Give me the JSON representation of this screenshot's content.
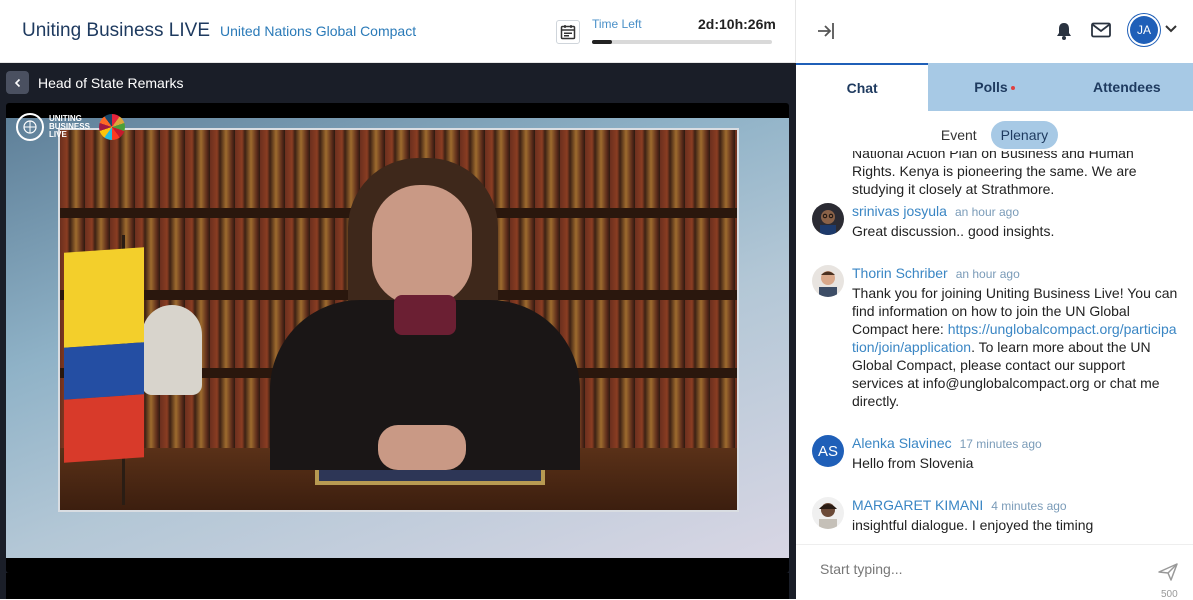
{
  "header": {
    "app_title": "Uniting Business LIVE",
    "org_link": "United Nations Global Compact",
    "time_left_label": "Time Left",
    "time_left_value": "2d:10h:26m",
    "time_progress_fraction": 0.11
  },
  "user": {
    "initials": "JA"
  },
  "stage": {
    "title": "Head of State Remarks",
    "logo_lines": [
      "UNITING",
      "BUSINESS",
      "LIVE"
    ]
  },
  "panel": {
    "tabs": [
      {
        "label": "Chat",
        "active": true
      },
      {
        "label": "Polls",
        "active": false,
        "has_notification": true
      },
      {
        "label": "Attendees",
        "active": false
      }
    ],
    "subtabs": [
      {
        "label": "Event",
        "active": false
      },
      {
        "label": "Plenary",
        "active": true
      }
    ],
    "messages": [
      {
        "name": "",
        "time": "",
        "text": "National Action Plan on Business and Human Rights. Kenya is pioneering the same. We are studying it closely at Strathmore."
      },
      {
        "name": "srinivas josyula",
        "time": "an hour ago",
        "text": "Great discussion.. good insights."
      },
      {
        "name": "Thorin Schriber",
        "time": "an hour ago",
        "text_before_link": "Thank you for joining Uniting Business Live! You can find information on how to join the UN Global Compact here: ",
        "link": "https://unglobalcompact.org/participation/join/application",
        "text_after_link": ". To learn more about the UN Global Compact, please contact our support services at info@unglobalcompact.org or chat me directly."
      },
      {
        "name": "Alenka Slavinec",
        "initials": "AS",
        "time": "17 minutes ago",
        "text": "Hello from Slovenia"
      },
      {
        "name": "MARGARET KIMANI",
        "time": "4 minutes ago",
        "text": "insightful dialogue. I enjoyed the timing"
      }
    ],
    "input_placeholder": "Start typing...",
    "char_limit": "500"
  },
  "colors": {
    "accent": "#1f5fb8",
    "tab_inactive": "#a7c9e5",
    "link": "#3a86c4",
    "stage_bg": "#1a1e28"
  },
  "icons": [
    "calendar-icon",
    "collapse-panel-icon",
    "bell-icon",
    "mail-icon",
    "chevron-down-icon",
    "back-chevron-icon",
    "send-icon"
  ]
}
